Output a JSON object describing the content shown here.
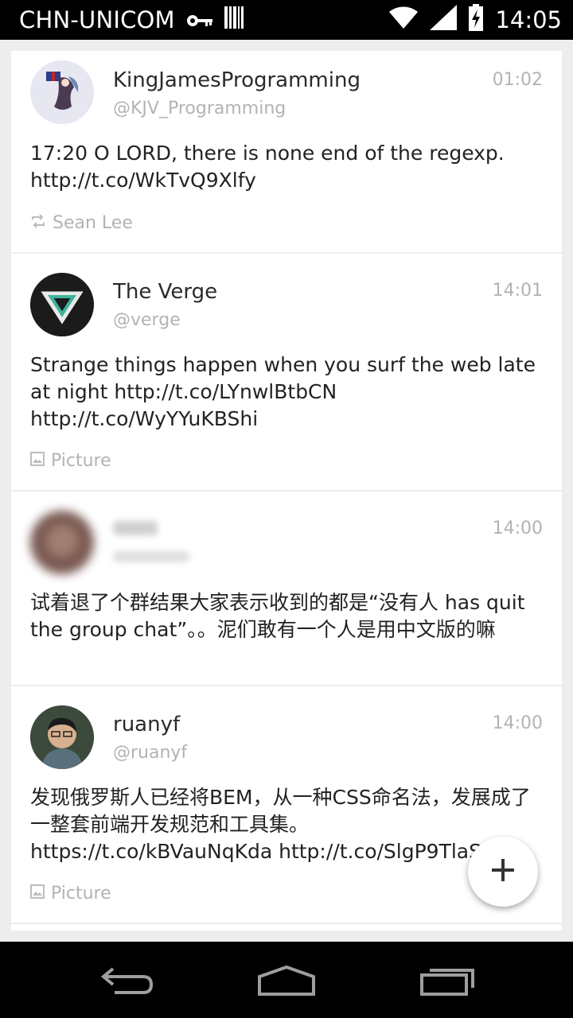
{
  "status_bar": {
    "carrier": "CHN-UNICOM",
    "time": "14:05",
    "icons": [
      "key-icon",
      "barcode-icon",
      "wifi-icon",
      "signal-icon",
      "battery-charging-icon"
    ]
  },
  "tweets": [
    {
      "name": "KingJamesProgramming",
      "handle": "@KJV_Programming",
      "time": "01:02",
      "text": "17:20 O LORD, there is none end of the regexp. http://t.co/WkTvQ9Xlfy",
      "meta": {
        "icon": "retweet-icon",
        "label": "Sean Lee"
      }
    },
    {
      "name": "The Verge",
      "handle": "@verge",
      "time": "14:01",
      "text": "Strange things happen when you surf the web late at night http://t.co/LYnwlBtbCN http://t.co/WyYYuKBShi",
      "meta": {
        "icon": "picture-icon",
        "label": "Picture"
      }
    },
    {
      "name": "",
      "handle": "",
      "time": "14:00",
      "text": "试着退了个群结果大家表示收到的都是“没有人 has quit the group chat”。。泥们敢有一个人是用中文版的嘛"
    },
    {
      "name": "ruanyf",
      "handle": "@ruanyf",
      "time": "14:00",
      "text": "发现俄罗斯人已经将BEM，从一种CSS命名法，发展成了一整套前端开发规范和工具集。 https://t.co/kBVauNqKda http://t.co/SlgP9TlaSe",
      "meta": {
        "icon": "picture-icon",
        "label": "Picture"
      }
    }
  ],
  "fab": {
    "icon": "plus-icon"
  },
  "nav_bar": {
    "icons": [
      "back-icon",
      "home-icon",
      "recents-icon"
    ]
  }
}
